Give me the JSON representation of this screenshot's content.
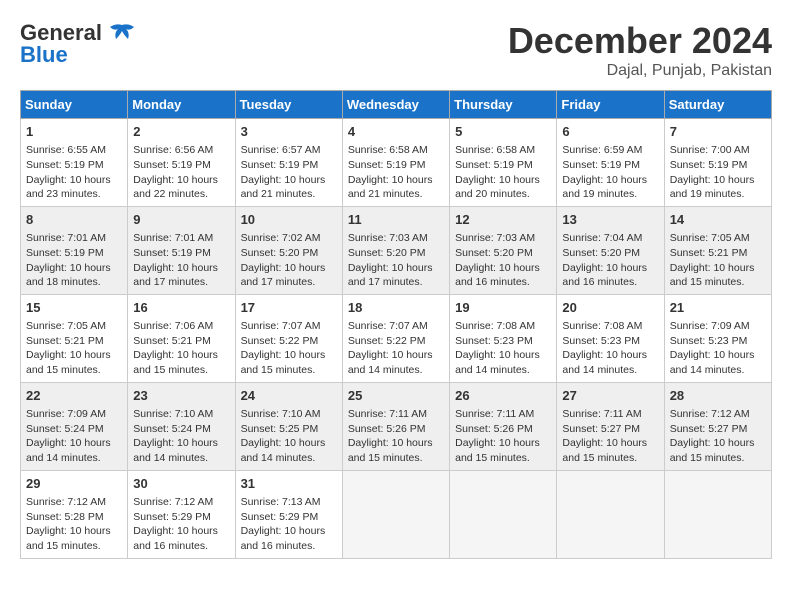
{
  "header": {
    "logo_line1": "General",
    "logo_line2": "Blue",
    "month": "December 2024",
    "location": "Dajal, Punjab, Pakistan"
  },
  "days_of_week": [
    "Sunday",
    "Monday",
    "Tuesday",
    "Wednesday",
    "Thursday",
    "Friday",
    "Saturday"
  ],
  "weeks": [
    [
      {
        "day": 1,
        "sunrise": "6:55 AM",
        "sunset": "5:19 PM",
        "daylight": "10 hours and 23 minutes."
      },
      {
        "day": 2,
        "sunrise": "6:56 AM",
        "sunset": "5:19 PM",
        "daylight": "10 hours and 22 minutes."
      },
      {
        "day": 3,
        "sunrise": "6:57 AM",
        "sunset": "5:19 PM",
        "daylight": "10 hours and 21 minutes."
      },
      {
        "day": 4,
        "sunrise": "6:58 AM",
        "sunset": "5:19 PM",
        "daylight": "10 hours and 21 minutes."
      },
      {
        "day": 5,
        "sunrise": "6:58 AM",
        "sunset": "5:19 PM",
        "daylight": "10 hours and 20 minutes."
      },
      {
        "day": 6,
        "sunrise": "6:59 AM",
        "sunset": "5:19 PM",
        "daylight": "10 hours and 19 minutes."
      },
      {
        "day": 7,
        "sunrise": "7:00 AM",
        "sunset": "5:19 PM",
        "daylight": "10 hours and 19 minutes."
      }
    ],
    [
      {
        "day": 8,
        "sunrise": "7:01 AM",
        "sunset": "5:19 PM",
        "daylight": "10 hours and 18 minutes."
      },
      {
        "day": 9,
        "sunrise": "7:01 AM",
        "sunset": "5:19 PM",
        "daylight": "10 hours and 17 minutes."
      },
      {
        "day": 10,
        "sunrise": "7:02 AM",
        "sunset": "5:20 PM",
        "daylight": "10 hours and 17 minutes."
      },
      {
        "day": 11,
        "sunrise": "7:03 AM",
        "sunset": "5:20 PM",
        "daylight": "10 hours and 17 minutes."
      },
      {
        "day": 12,
        "sunrise": "7:03 AM",
        "sunset": "5:20 PM",
        "daylight": "10 hours and 16 minutes."
      },
      {
        "day": 13,
        "sunrise": "7:04 AM",
        "sunset": "5:20 PM",
        "daylight": "10 hours and 16 minutes."
      },
      {
        "day": 14,
        "sunrise": "7:05 AM",
        "sunset": "5:21 PM",
        "daylight": "10 hours and 15 minutes."
      }
    ],
    [
      {
        "day": 15,
        "sunrise": "7:05 AM",
        "sunset": "5:21 PM",
        "daylight": "10 hours and 15 minutes."
      },
      {
        "day": 16,
        "sunrise": "7:06 AM",
        "sunset": "5:21 PM",
        "daylight": "10 hours and 15 minutes."
      },
      {
        "day": 17,
        "sunrise": "7:07 AM",
        "sunset": "5:22 PM",
        "daylight": "10 hours and 15 minutes."
      },
      {
        "day": 18,
        "sunrise": "7:07 AM",
        "sunset": "5:22 PM",
        "daylight": "10 hours and 14 minutes."
      },
      {
        "day": 19,
        "sunrise": "7:08 AM",
        "sunset": "5:23 PM",
        "daylight": "10 hours and 14 minutes."
      },
      {
        "day": 20,
        "sunrise": "7:08 AM",
        "sunset": "5:23 PM",
        "daylight": "10 hours and 14 minutes."
      },
      {
        "day": 21,
        "sunrise": "7:09 AM",
        "sunset": "5:23 PM",
        "daylight": "10 hours and 14 minutes."
      }
    ],
    [
      {
        "day": 22,
        "sunrise": "7:09 AM",
        "sunset": "5:24 PM",
        "daylight": "10 hours and 14 minutes."
      },
      {
        "day": 23,
        "sunrise": "7:10 AM",
        "sunset": "5:24 PM",
        "daylight": "10 hours and 14 minutes."
      },
      {
        "day": 24,
        "sunrise": "7:10 AM",
        "sunset": "5:25 PM",
        "daylight": "10 hours and 14 minutes."
      },
      {
        "day": 25,
        "sunrise": "7:11 AM",
        "sunset": "5:26 PM",
        "daylight": "10 hours and 15 minutes."
      },
      {
        "day": 26,
        "sunrise": "7:11 AM",
        "sunset": "5:26 PM",
        "daylight": "10 hours and 15 minutes."
      },
      {
        "day": 27,
        "sunrise": "7:11 AM",
        "sunset": "5:27 PM",
        "daylight": "10 hours and 15 minutes."
      },
      {
        "day": 28,
        "sunrise": "7:12 AM",
        "sunset": "5:27 PM",
        "daylight": "10 hours and 15 minutes."
      }
    ],
    [
      {
        "day": 29,
        "sunrise": "7:12 AM",
        "sunset": "5:28 PM",
        "daylight": "10 hours and 15 minutes."
      },
      {
        "day": 30,
        "sunrise": "7:12 AM",
        "sunset": "5:29 PM",
        "daylight": "10 hours and 16 minutes."
      },
      {
        "day": 31,
        "sunrise": "7:13 AM",
        "sunset": "5:29 PM",
        "daylight": "10 hours and 16 minutes."
      },
      null,
      null,
      null,
      null
    ]
  ]
}
